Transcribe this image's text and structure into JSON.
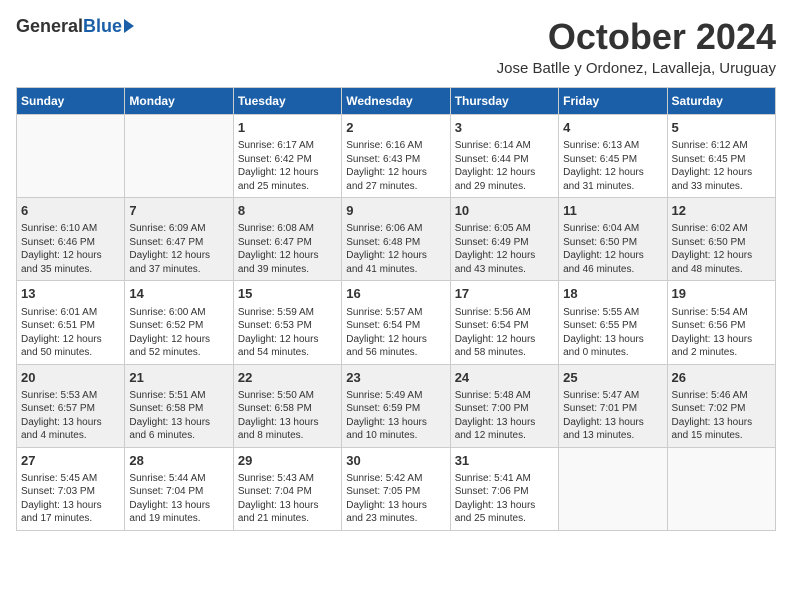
{
  "header": {
    "logo_general": "General",
    "logo_blue": "Blue",
    "month_title": "October 2024",
    "location": "Jose Batlle y Ordonez, Lavalleja, Uruguay"
  },
  "weekdays": [
    "Sunday",
    "Monday",
    "Tuesday",
    "Wednesday",
    "Thursday",
    "Friday",
    "Saturday"
  ],
  "weeks": [
    [
      {
        "day": "",
        "info": ""
      },
      {
        "day": "",
        "info": ""
      },
      {
        "day": "1",
        "info": "Sunrise: 6:17 AM\nSunset: 6:42 PM\nDaylight: 12 hours\nand 25 minutes."
      },
      {
        "day": "2",
        "info": "Sunrise: 6:16 AM\nSunset: 6:43 PM\nDaylight: 12 hours\nand 27 minutes."
      },
      {
        "day": "3",
        "info": "Sunrise: 6:14 AM\nSunset: 6:44 PM\nDaylight: 12 hours\nand 29 minutes."
      },
      {
        "day": "4",
        "info": "Sunrise: 6:13 AM\nSunset: 6:45 PM\nDaylight: 12 hours\nand 31 minutes."
      },
      {
        "day": "5",
        "info": "Sunrise: 6:12 AM\nSunset: 6:45 PM\nDaylight: 12 hours\nand 33 minutes."
      }
    ],
    [
      {
        "day": "6",
        "info": "Sunrise: 6:10 AM\nSunset: 6:46 PM\nDaylight: 12 hours\nand 35 minutes."
      },
      {
        "day": "7",
        "info": "Sunrise: 6:09 AM\nSunset: 6:47 PM\nDaylight: 12 hours\nand 37 minutes."
      },
      {
        "day": "8",
        "info": "Sunrise: 6:08 AM\nSunset: 6:47 PM\nDaylight: 12 hours\nand 39 minutes."
      },
      {
        "day": "9",
        "info": "Sunrise: 6:06 AM\nSunset: 6:48 PM\nDaylight: 12 hours\nand 41 minutes."
      },
      {
        "day": "10",
        "info": "Sunrise: 6:05 AM\nSunset: 6:49 PM\nDaylight: 12 hours\nand 43 minutes."
      },
      {
        "day": "11",
        "info": "Sunrise: 6:04 AM\nSunset: 6:50 PM\nDaylight: 12 hours\nand 46 minutes."
      },
      {
        "day": "12",
        "info": "Sunrise: 6:02 AM\nSunset: 6:50 PM\nDaylight: 12 hours\nand 48 minutes."
      }
    ],
    [
      {
        "day": "13",
        "info": "Sunrise: 6:01 AM\nSunset: 6:51 PM\nDaylight: 12 hours\nand 50 minutes."
      },
      {
        "day": "14",
        "info": "Sunrise: 6:00 AM\nSunset: 6:52 PM\nDaylight: 12 hours\nand 52 minutes."
      },
      {
        "day": "15",
        "info": "Sunrise: 5:59 AM\nSunset: 6:53 PM\nDaylight: 12 hours\nand 54 minutes."
      },
      {
        "day": "16",
        "info": "Sunrise: 5:57 AM\nSunset: 6:54 PM\nDaylight: 12 hours\nand 56 minutes."
      },
      {
        "day": "17",
        "info": "Sunrise: 5:56 AM\nSunset: 6:54 PM\nDaylight: 12 hours\nand 58 minutes."
      },
      {
        "day": "18",
        "info": "Sunrise: 5:55 AM\nSunset: 6:55 PM\nDaylight: 13 hours\nand 0 minutes."
      },
      {
        "day": "19",
        "info": "Sunrise: 5:54 AM\nSunset: 6:56 PM\nDaylight: 13 hours\nand 2 minutes."
      }
    ],
    [
      {
        "day": "20",
        "info": "Sunrise: 5:53 AM\nSunset: 6:57 PM\nDaylight: 13 hours\nand 4 minutes."
      },
      {
        "day": "21",
        "info": "Sunrise: 5:51 AM\nSunset: 6:58 PM\nDaylight: 13 hours\nand 6 minutes."
      },
      {
        "day": "22",
        "info": "Sunrise: 5:50 AM\nSunset: 6:58 PM\nDaylight: 13 hours\nand 8 minutes."
      },
      {
        "day": "23",
        "info": "Sunrise: 5:49 AM\nSunset: 6:59 PM\nDaylight: 13 hours\nand 10 minutes."
      },
      {
        "day": "24",
        "info": "Sunrise: 5:48 AM\nSunset: 7:00 PM\nDaylight: 13 hours\nand 12 minutes."
      },
      {
        "day": "25",
        "info": "Sunrise: 5:47 AM\nSunset: 7:01 PM\nDaylight: 13 hours\nand 13 minutes."
      },
      {
        "day": "26",
        "info": "Sunrise: 5:46 AM\nSunset: 7:02 PM\nDaylight: 13 hours\nand 15 minutes."
      }
    ],
    [
      {
        "day": "27",
        "info": "Sunrise: 5:45 AM\nSunset: 7:03 PM\nDaylight: 13 hours\nand 17 minutes."
      },
      {
        "day": "28",
        "info": "Sunrise: 5:44 AM\nSunset: 7:04 PM\nDaylight: 13 hours\nand 19 minutes."
      },
      {
        "day": "29",
        "info": "Sunrise: 5:43 AM\nSunset: 7:04 PM\nDaylight: 13 hours\nand 21 minutes."
      },
      {
        "day": "30",
        "info": "Sunrise: 5:42 AM\nSunset: 7:05 PM\nDaylight: 13 hours\nand 23 minutes."
      },
      {
        "day": "31",
        "info": "Sunrise: 5:41 AM\nSunset: 7:06 PM\nDaylight: 13 hours\nand 25 minutes."
      },
      {
        "day": "",
        "info": ""
      },
      {
        "day": "",
        "info": ""
      }
    ]
  ]
}
